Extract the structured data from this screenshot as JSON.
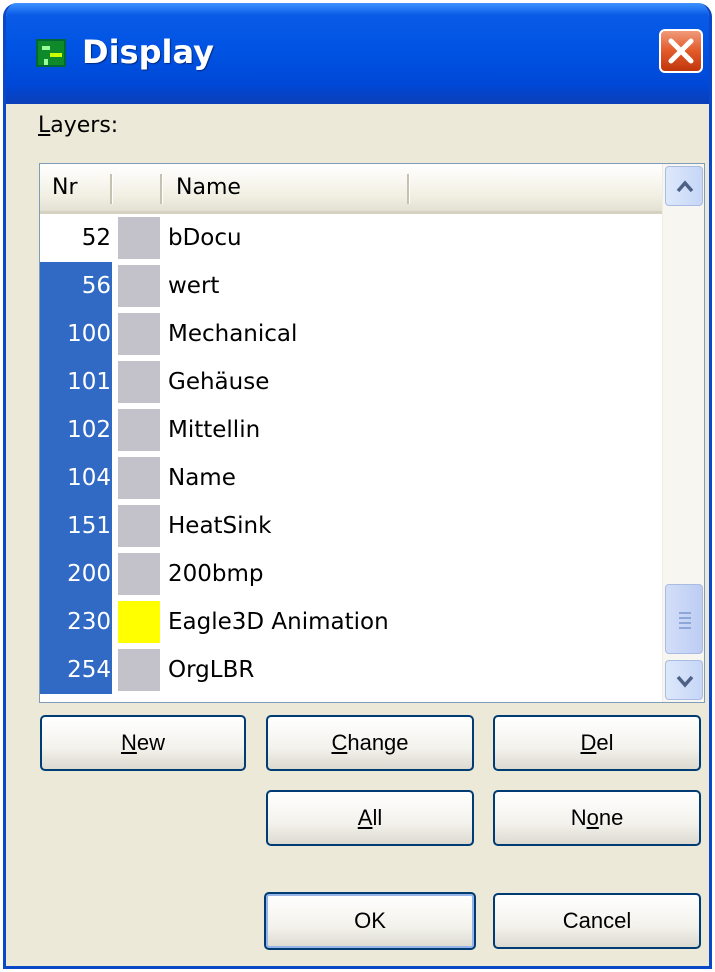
{
  "window": {
    "title": "Display"
  },
  "layers_label": {
    "prefix": "L",
    "rest": "ayers:"
  },
  "columns": {
    "nr": "Nr",
    "name": "Name"
  },
  "layers": [
    {
      "nr": "52",
      "name": "bDocu",
      "selected": false,
      "color": "#c3c2ca"
    },
    {
      "nr": "56",
      "name": "wert",
      "selected": true,
      "color": "#c3c2ca"
    },
    {
      "nr": "100",
      "name": "Mechanical",
      "selected": true,
      "color": "#c3c2ca"
    },
    {
      "nr": "101",
      "name": "Gehäuse",
      "selected": true,
      "color": "#c3c2ca"
    },
    {
      "nr": "102",
      "name": "Mittellin",
      "selected": true,
      "color": "#c3c2ca"
    },
    {
      "nr": "104",
      "name": "Name",
      "selected": true,
      "color": "#c3c2ca"
    },
    {
      "nr": "151",
      "name": "HeatSink",
      "selected": true,
      "color": "#c3c2ca"
    },
    {
      "nr": "200",
      "name": "200bmp",
      "selected": true,
      "color": "#c3c2ca"
    },
    {
      "nr": "230",
      "name": "Eagle3D Animation",
      "selected": true,
      "color": "#ffff00"
    },
    {
      "nr": "254",
      "name": "OrgLBR",
      "selected": true,
      "color": "#c3c2ca"
    }
  ],
  "buttons": {
    "new": {
      "mnemonic": "N",
      "rest": "ew"
    },
    "change": {
      "mnemonic": "C",
      "rest": "hange"
    },
    "del": {
      "mnemonic": "D",
      "rest": "el"
    },
    "all": {
      "mnemonic": "A",
      "rest": "ll"
    },
    "none": {
      "pre": "N",
      "mnemonic": "o",
      "rest": "ne"
    },
    "ok": {
      "label": "OK"
    },
    "cancel": {
      "label": "Cancel"
    }
  },
  "icons": {
    "app": "eagle-app-icon",
    "close": "close-icon",
    "up": "arrow-up-icon",
    "down": "arrow-down-icon",
    "grip": "scroll-grip-icon"
  },
  "colors": {
    "titlebar": "#0054e3",
    "selection": "#316ac5",
    "face": "#ece9d8"
  }
}
